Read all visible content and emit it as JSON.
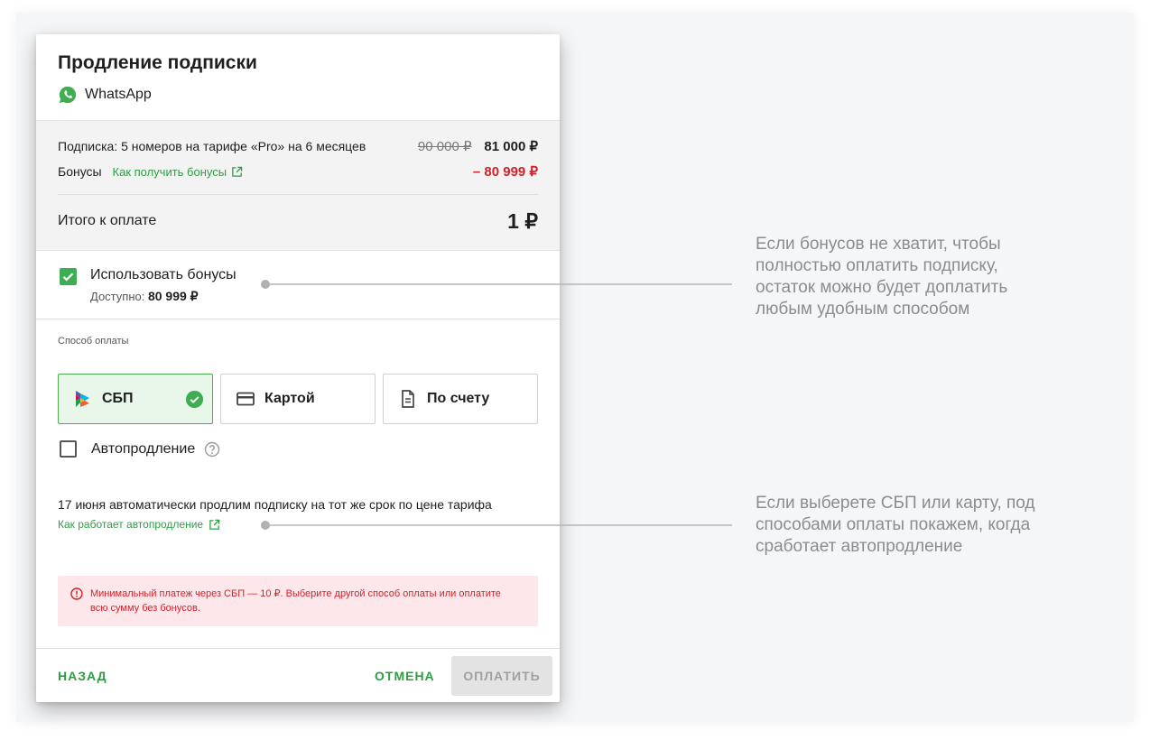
{
  "dialog": {
    "title": "Продление подписки",
    "app_name": "WhatsApp"
  },
  "summary": {
    "subscription_label": "Подписка: 5 номеров на тарифе «Pro» на 6 месяцев",
    "old_price": "90 000 ₽",
    "new_price": "81 000 ₽",
    "bonuses_label": "Бонусы",
    "bonuses_link": "Как получить бонусы",
    "bonuses_amount": "– 80 999 ₽",
    "total_label": "Итого к оплате",
    "total_value": "1 ₽"
  },
  "bonus_option": {
    "label": "Использовать бонусы",
    "available_label": "Доступно:",
    "available_value": "80 999 ₽",
    "checked": true
  },
  "payment": {
    "caption": "Способ оплаты",
    "methods": [
      {
        "label": "СБП",
        "icon": "sbp-logo-icon",
        "selected": true
      },
      {
        "label": "Картой",
        "icon": "credit-card-icon",
        "selected": false
      },
      {
        "label": "По счету",
        "icon": "document-icon",
        "selected": false
      }
    ]
  },
  "autorenew": {
    "label": "Автопродление",
    "checked": false,
    "info": "17 июня автоматически продлим подписку на тот же срок по цене тарифа",
    "link": "Как работает автопродление"
  },
  "error": {
    "text": "Минимальный платеж через СБП — 10 ₽. Выберите другой способ оплаты или оплатите всю сумму без бонусов."
  },
  "footer": {
    "back": "НАЗАД",
    "cancel": "ОТМЕНА",
    "pay": "ОПЛАТИТЬ"
  },
  "notes": {
    "bonus_note": "Если бонусов не хватит, чтобы полностью оплатить подписку, остаток можно будет доплатить любым удобным способом",
    "autorenew_note": "Если выберете СБП или карту, под способами оплаты покажем, когда сработает автопродление"
  },
  "colors": {
    "accent_green": "#3fad51",
    "error_red": "#d3222a",
    "error_bg": "#fde7ea"
  }
}
